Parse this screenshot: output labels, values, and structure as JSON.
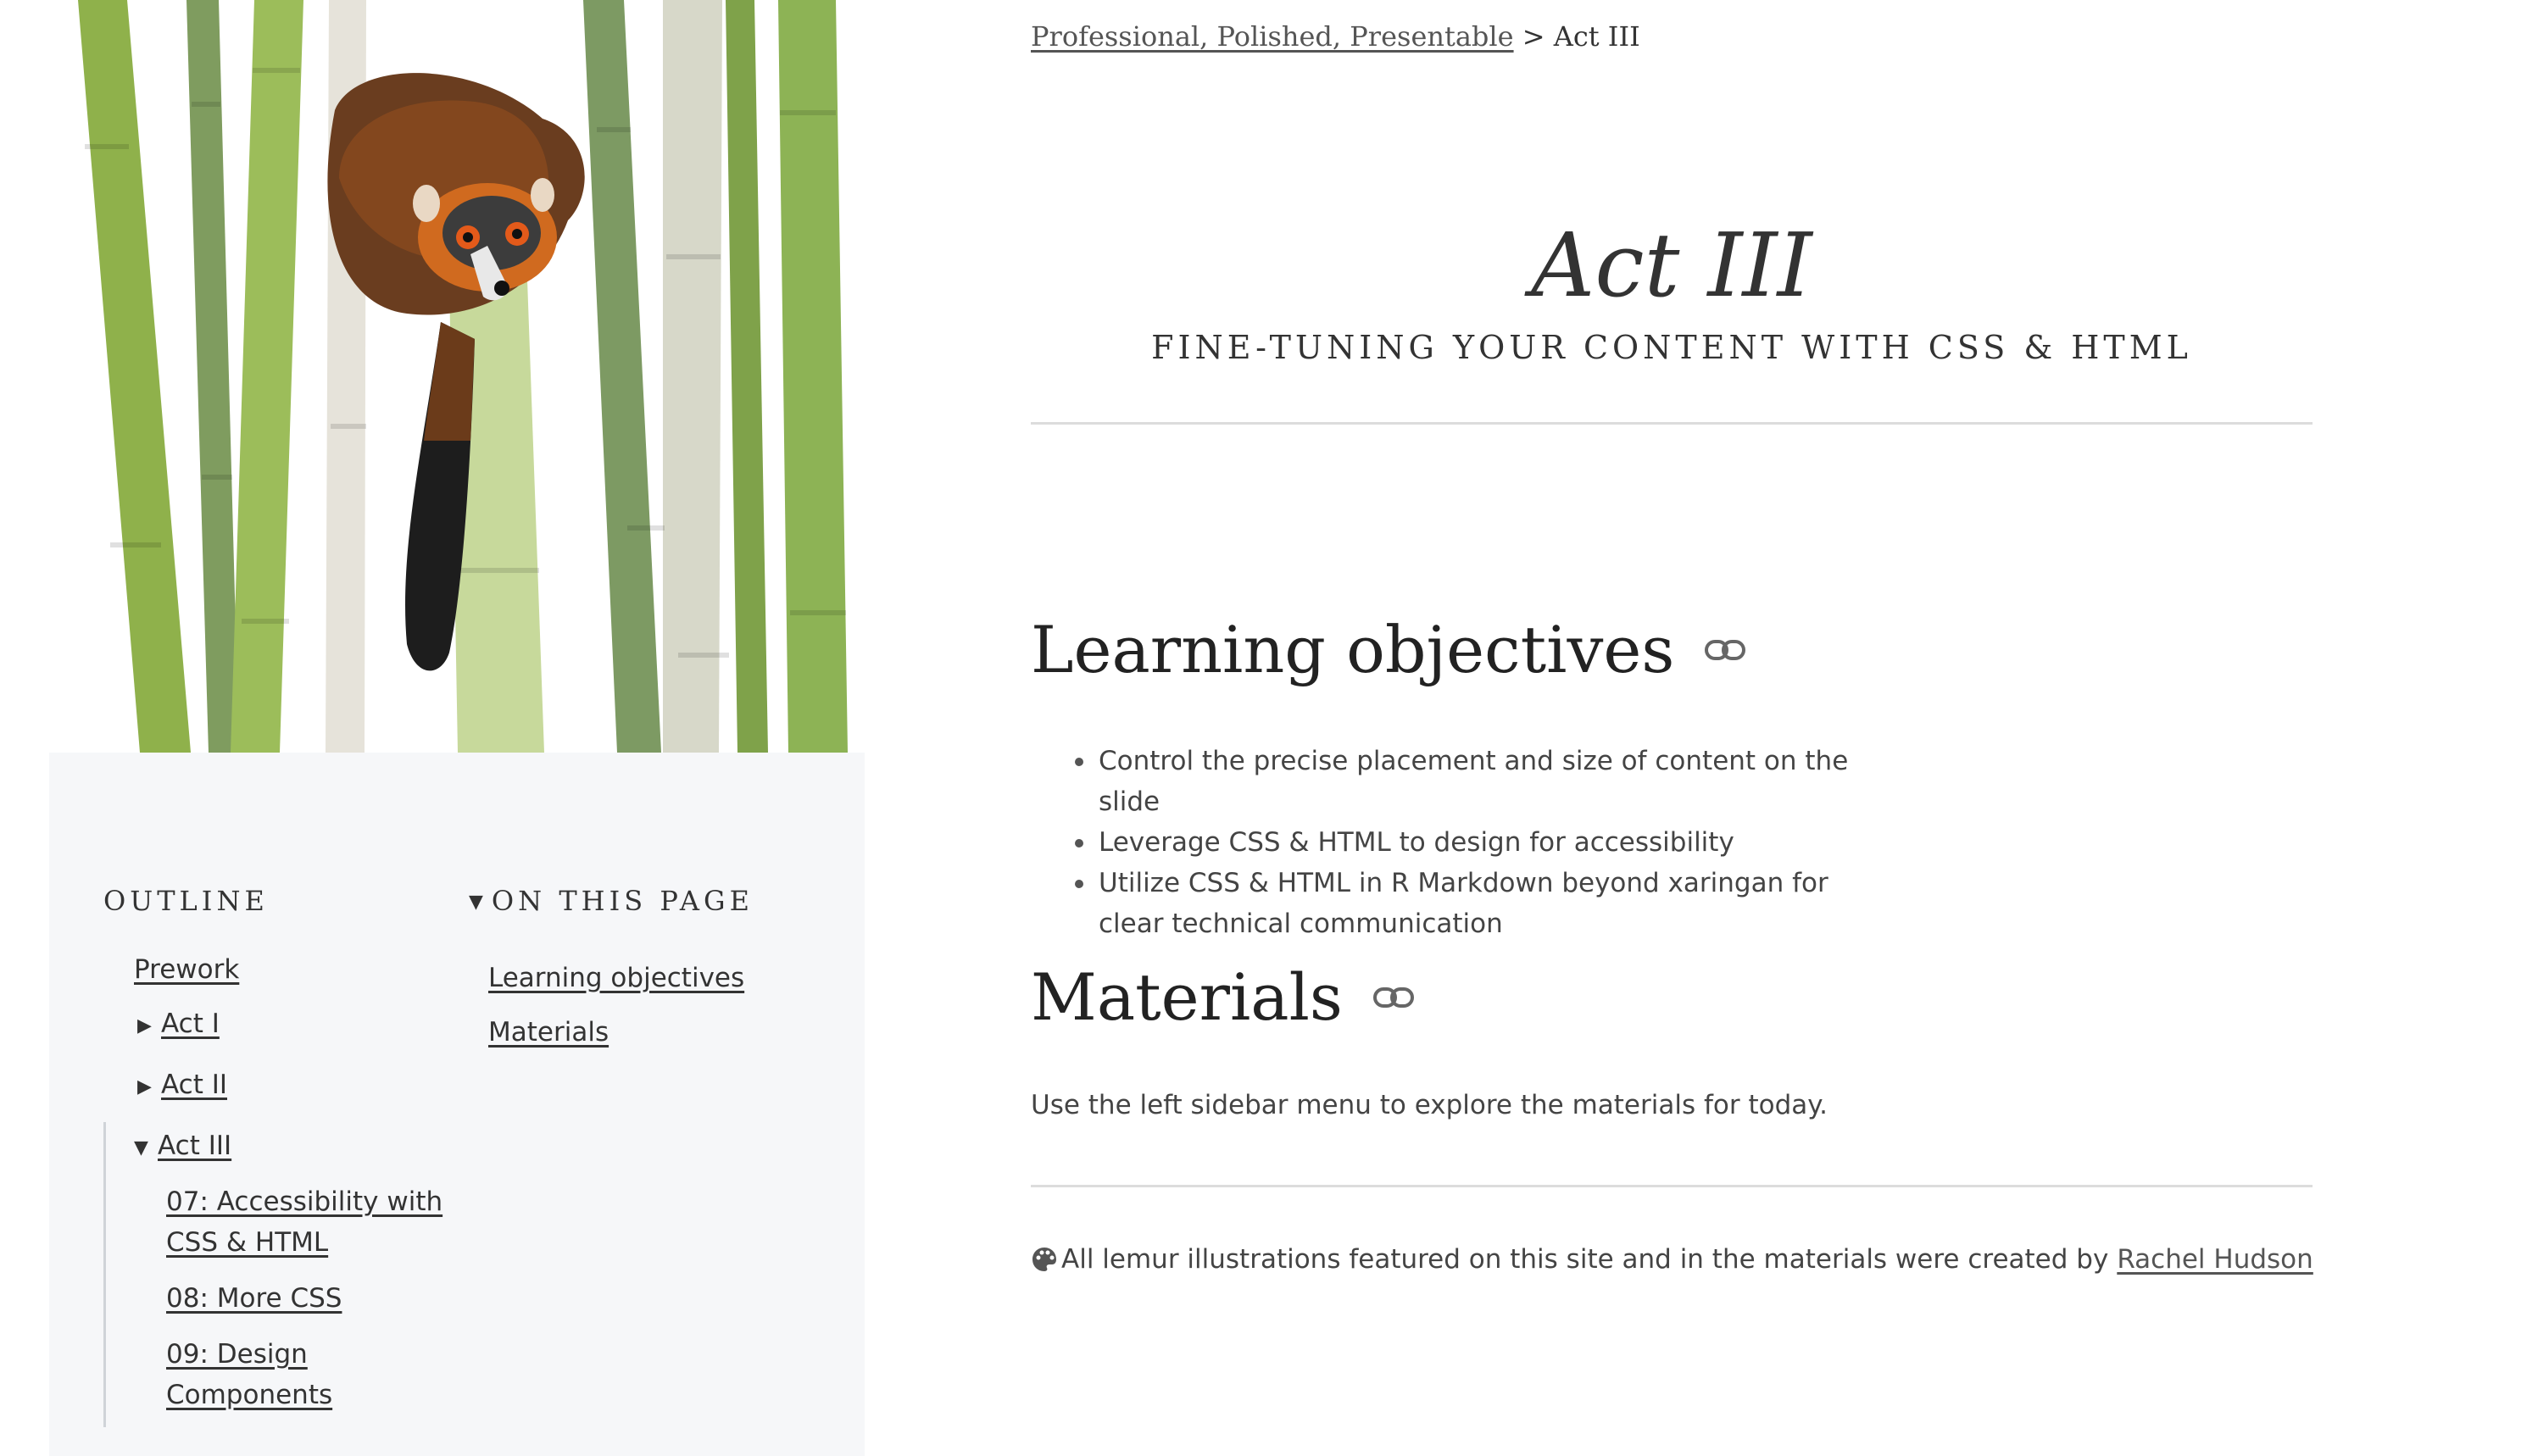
{
  "breadcrumb": {
    "parent": "Professional, Polished, Presentable",
    "separator": ">",
    "current": "Act III"
  },
  "header": {
    "title": "Act III",
    "subtitle": "FINE-TUNING YOUR CONTENT WITH CSS & HTML"
  },
  "sidebar": {
    "outline_heading": "OUTLINE",
    "on_this_page_heading": "ON THIS PAGE",
    "outline": {
      "prework": "Prework",
      "act1": "Act I",
      "act2": "Act II",
      "act3": "Act III",
      "act3_children": [
        "07: Accessibility with",
        "CSS & HTML",
        "08: More CSS",
        "09: Design",
        "Components"
      ]
    },
    "on_this_page": [
      "Learning objectives",
      "Materials"
    ]
  },
  "main": {
    "learning_heading": "Learning objectives",
    "objectives": [
      "Control the precise placement and size of content on the slide",
      "Leverage CSS & HTML to design for accessibility",
      "Utilize CSS & HTML in R Markdown beyond xaringan for clear technical communication"
    ],
    "materials_heading": "Materials",
    "materials_text": "Use the left sidebar menu to explore the materials for today."
  },
  "footer": {
    "credit_text": "All lemur illustrations featured on this site and in the materials were created by",
    "credit_link": "Rachel Hudson"
  },
  "icons": {
    "link": "link-icon",
    "palette": "palette-icon",
    "expand": "triangle-right-icon",
    "collapse": "triangle-down-icon"
  }
}
